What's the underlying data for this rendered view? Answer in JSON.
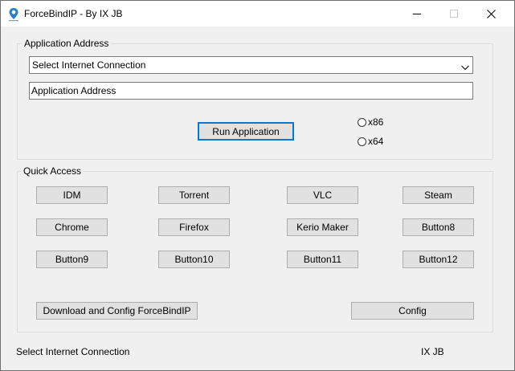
{
  "window": {
    "title": "ForceBindIP - By IX JB",
    "icon": "app-pin-icon"
  },
  "app_address_group": {
    "label": "Application Address",
    "connection_select": {
      "value": "Select Internet Connection"
    },
    "address_input": {
      "value": "Application Address"
    },
    "run_button": "Run Application",
    "arch_options": [
      "x86",
      "x64"
    ]
  },
  "quick_access": {
    "label": "Quick Access",
    "buttons": [
      "IDM",
      "Torrent",
      "VLC",
      "Steam",
      "Chrome",
      "Firefox",
      "Kerio Maker",
      "Button8",
      "Button9",
      "Button10",
      "Button11",
      "Button12"
    ],
    "download_button": "Download and Config ForceBindIP",
    "config_button": "Config"
  },
  "statusbar": {
    "left": "Select Internet Connection",
    "right": "IX JB"
  }
}
